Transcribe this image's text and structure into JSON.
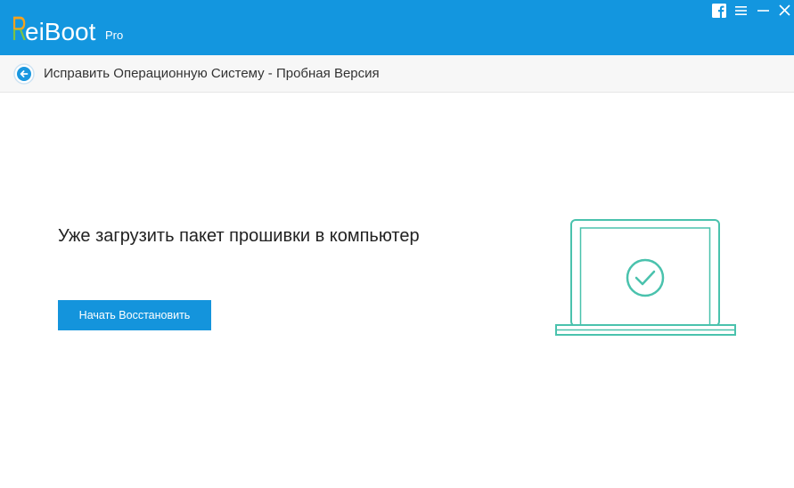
{
  "header": {
    "brand": {
      "logo_initial": "R",
      "logo_rest": "eiBoot",
      "edition": "Pro"
    },
    "icons": {
      "facebook": "facebook-icon",
      "menu": "menu-icon",
      "minimize": "minimize-icon",
      "close": "close-icon"
    }
  },
  "nav": {
    "back_icon": "back-arrow-icon",
    "title": "Исправить Операционную Систему - Пробная Версия"
  },
  "main": {
    "heading": "Уже загрузить пакет прошивки в компьютер",
    "restore_button_label": "Начать Восстановить",
    "illustration_icon": "laptop-check-icon"
  },
  "colors": {
    "header": "#1396df",
    "button": "#1494dc",
    "illustration": "#4ac2ad",
    "nav_bar": "#f7f7f7",
    "nav_border": "#e6e6e6",
    "text_dark": "#222222",
    "accent_orange": "#f6a21c",
    "accent_green": "#7cc242"
  }
}
